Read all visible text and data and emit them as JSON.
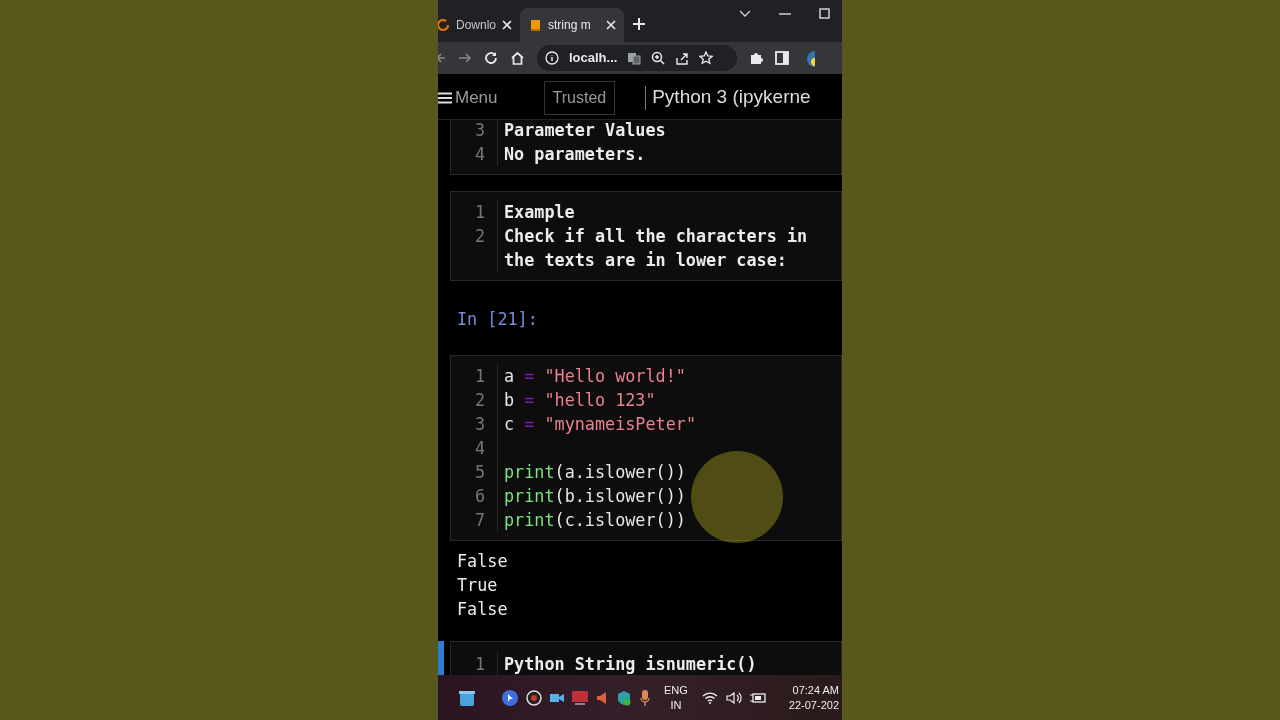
{
  "browser": {
    "tabs": [
      {
        "label": "Downlo",
        "selected": false,
        "kind": "loading"
      },
      {
        "label": "string m",
        "selected": true,
        "kind": "notebook"
      }
    ],
    "address": "localh..."
  },
  "notebook": {
    "menu": "Menu",
    "trusted": "Trusted",
    "kernel": "Python 3 (ipykerne"
  },
  "cells": [
    {
      "kind": "markdown",
      "selected": false,
      "lines": [
        {
          "n": "3",
          "text": "Parameter Values"
        },
        {
          "n": "4",
          "text": "No parameters."
        }
      ]
    },
    {
      "kind": "markdown",
      "selected": false,
      "lines": [
        {
          "n": "1",
          "text": "Example"
        },
        {
          "n": "2",
          "text": "Check if all the characters in the texts are in lower case:"
        }
      ]
    },
    {
      "kind": "code",
      "selected": false,
      "prompt": "In [21]:",
      "lines": [
        {
          "n": "1",
          "tokens": [
            {
              "text": "a ",
              "kind": "name"
            },
            {
              "text": "=",
              "kind": "op"
            },
            {
              "text": " \"Hello world!\"",
              "kind": "string"
            }
          ]
        },
        {
          "n": "2",
          "tokens": [
            {
              "text": "b ",
              "kind": "name"
            },
            {
              "text": "=",
              "kind": "op"
            },
            {
              "text": " \"hello 123\"",
              "kind": "string"
            }
          ]
        },
        {
          "n": "3",
          "tokens": [
            {
              "text": "c ",
              "kind": "name"
            },
            {
              "text": "=",
              "kind": "op"
            },
            {
              "text": " \"mynameisPeter\"",
              "kind": "string"
            }
          ]
        },
        {
          "n": "4"
        },
        {
          "n": "5",
          "tokens": [
            {
              "text": "print",
              "kind": "builtin"
            },
            {
              "text": "(a.islower())",
              "kind": "name"
            }
          ]
        },
        {
          "n": "6",
          "tokens": [
            {
              "text": "print",
              "kind": "builtin"
            },
            {
              "text": "(b.islower())",
              "kind": "name"
            }
          ]
        },
        {
          "n": "7",
          "tokens": [
            {
              "text": "print",
              "kind": "builtin"
            },
            {
              "text": "(c.islower())",
              "kind": "name"
            }
          ]
        }
      ],
      "output": [
        "False",
        "True",
        "False"
      ]
    },
    {
      "kind": "markdown",
      "selected": true,
      "lines": [
        {
          "n": "1",
          "text": "Python String isnumeric()"
        }
      ]
    }
  ],
  "taskbar": {
    "language": "ENG",
    "region": "IN",
    "time": "07:24 AM",
    "date": "22-07-202"
  }
}
